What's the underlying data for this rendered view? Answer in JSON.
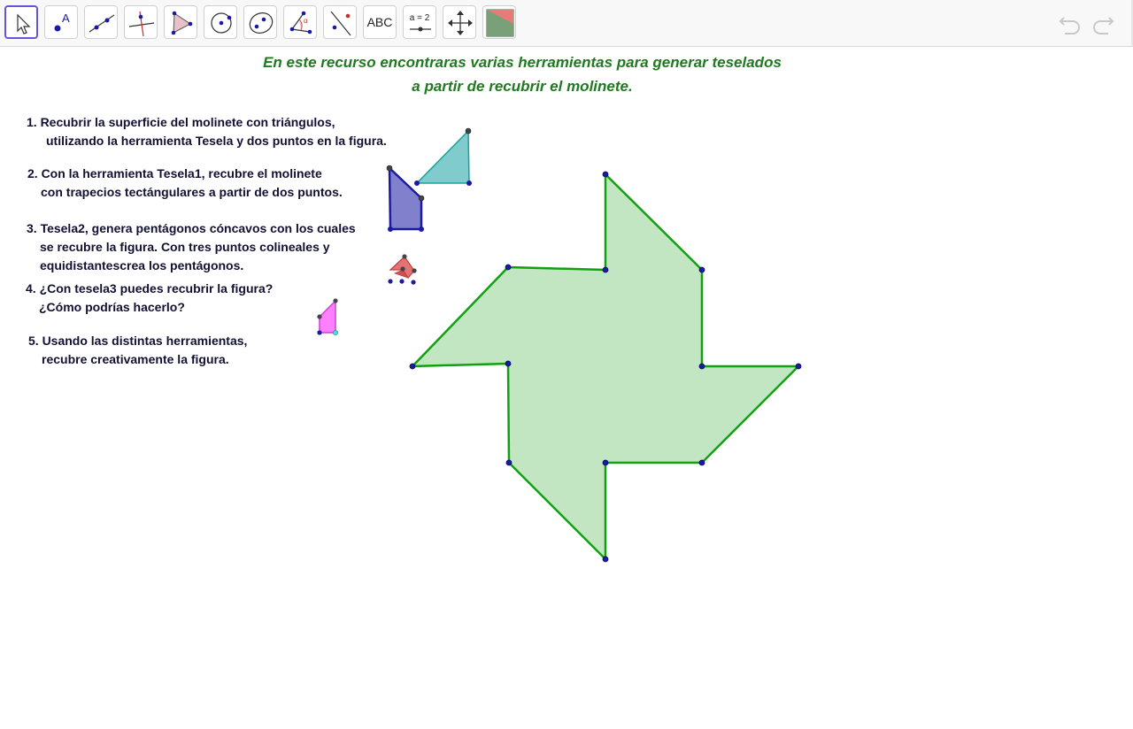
{
  "toolbar": {
    "tools": [
      {
        "name": "move-tool",
        "icon": "cursor-arrow-icon"
      },
      {
        "name": "point-tool",
        "icon": "point-icon",
        "label": "A"
      },
      {
        "name": "line-tool",
        "icon": "line-through-points-icon"
      },
      {
        "name": "perpendicular-line-tool",
        "icon": "perpendicular-line-icon"
      },
      {
        "name": "polygon-tool",
        "icon": "polygon-icon"
      },
      {
        "name": "circle-center-point-tool",
        "icon": "circle-center-icon"
      },
      {
        "name": "ellipse-tool",
        "icon": "ellipse-icon"
      },
      {
        "name": "angle-tool",
        "icon": "angle-icon",
        "label": "α"
      },
      {
        "name": "reflect-tool",
        "icon": "reflect-about-line-icon"
      },
      {
        "name": "text-tool",
        "icon": "text-icon",
        "label": "ABC"
      },
      {
        "name": "slider-tool",
        "icon": "slider-icon",
        "label": "a = 2"
      },
      {
        "name": "move-graphics-view-tool",
        "icon": "move-arrows-icon"
      },
      {
        "name": "custom-tesela-tool",
        "icon": "custom-tool-icon"
      }
    ],
    "undo_icon": "undo-icon",
    "redo_icon": "redo-icon"
  },
  "header": {
    "line1": "En este recurso encontraras varias herramientas para generar teselados",
    "line2": "a partir de recubrir el molinete."
  },
  "instructions": [
    {
      "line1": "1. Recubrir la superficie del molinete con triángulos,",
      "line2": "utilizando la herramienta Tesela y dos puntos en la figura."
    },
    {
      "line1": "2. Con la herramienta Tesela1, recubre el molinete",
      "line2": "con trapecios tectángulares a partir de dos puntos."
    },
    {
      "line1": "3. Tesela2, genera pentágonos cóncavos con los cuales",
      "line2": "se recubre la figura. Con tres puntos colineales y",
      "line3": "equidistantescrea los pentágonos."
    },
    {
      "line1": "4. ¿Con tesela3 puedes recubrir la figura?",
      "line2": "¿Cómo podrías hacerlo?"
    },
    {
      "line1": "5. Usando las distintas herramientas,",
      "line2": "recubre creativamente la figura."
    }
  ],
  "colors": {
    "accent": "#6557d2",
    "header_text": "#1f7a1f",
    "molinete_fill": "#c2e6c2",
    "molinete_stroke": "#11a011",
    "point_blue": "#1a1aa6",
    "point_dark": "#333333",
    "teal_tile": "#80cccc",
    "blue_tile": "#8080cc",
    "red_tile": "#e57373",
    "pink_tile": "#ff80ff"
  }
}
